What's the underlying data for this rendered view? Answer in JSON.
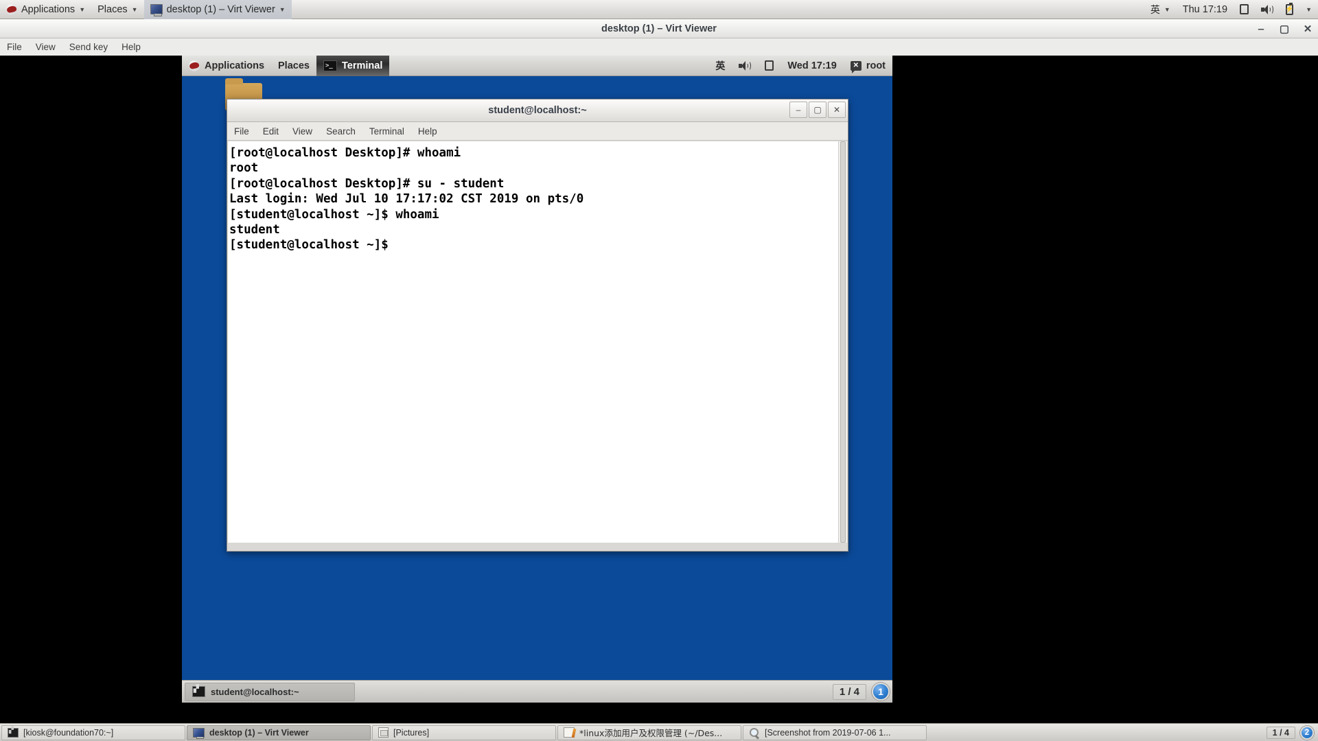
{
  "host_panel": {
    "applications_label": "Applications",
    "places_label": "Places",
    "window_button_label": "desktop (1) – Virt Viewer",
    "ime_label": "英",
    "clock": "Thu 17:19",
    "icons": [
      "display-icon",
      "volume-icon",
      "battery-icon",
      "chevron-down-icon"
    ]
  },
  "virt_viewer": {
    "title": "desktop (1) – Virt Viewer",
    "menu": [
      "File",
      "View",
      "Send key",
      "Help"
    ],
    "window_controls": {
      "minimize": "‒",
      "maximize": "▢",
      "close": "✕"
    }
  },
  "guest_panel": {
    "applications_label": "Applications",
    "places_label": "Places",
    "active_window_label": "Terminal",
    "ime_label": "英",
    "clock": "Wed 17:19",
    "user_label": "root"
  },
  "terminal_window": {
    "title": "student@localhost:~",
    "menu": [
      "File",
      "Edit",
      "View",
      "Search",
      "Terminal",
      "Help"
    ],
    "window_controls": {
      "minimize": "‒",
      "maximize": "▢",
      "close": "✕"
    },
    "content": "[root@localhost Desktop]# whoami\nroot\n[root@localhost Desktop]# su - student\nLast login: Wed Jul 10 17:17:02 CST 2019 on pts/0\n[student@localhost ~]$ whoami\nstudent\n[student@localhost ~]$ "
  },
  "guest_taskbar": {
    "task_label": "student@localhost:~",
    "workspace_count": "1 / 4",
    "workspace_badge": "1"
  },
  "host_taskbar": {
    "items": [
      {
        "label": "[kiosk@foundation70:~]",
        "icon": "terminal-icon",
        "active": false
      },
      {
        "label": "desktop (1) – Virt Viewer",
        "icon": "display-icon",
        "active": true
      },
      {
        "label": "[Pictures]",
        "icon": "folder-picture-icon",
        "active": false
      },
      {
        "label": "*linux添加用户及权限管理 (~/Des...",
        "icon": "text-editor-icon",
        "active": false
      },
      {
        "label": "[Screenshot from 2019-07-06 1...",
        "icon": "image-viewer-icon",
        "active": false
      }
    ],
    "workspace_count": "1 / 4",
    "workspace_badge": "2"
  },
  "colors": {
    "desktop_blue": "#0b4a99",
    "panel_gray": "#d5d4d1",
    "accent_blue": "#2f7fd0"
  }
}
